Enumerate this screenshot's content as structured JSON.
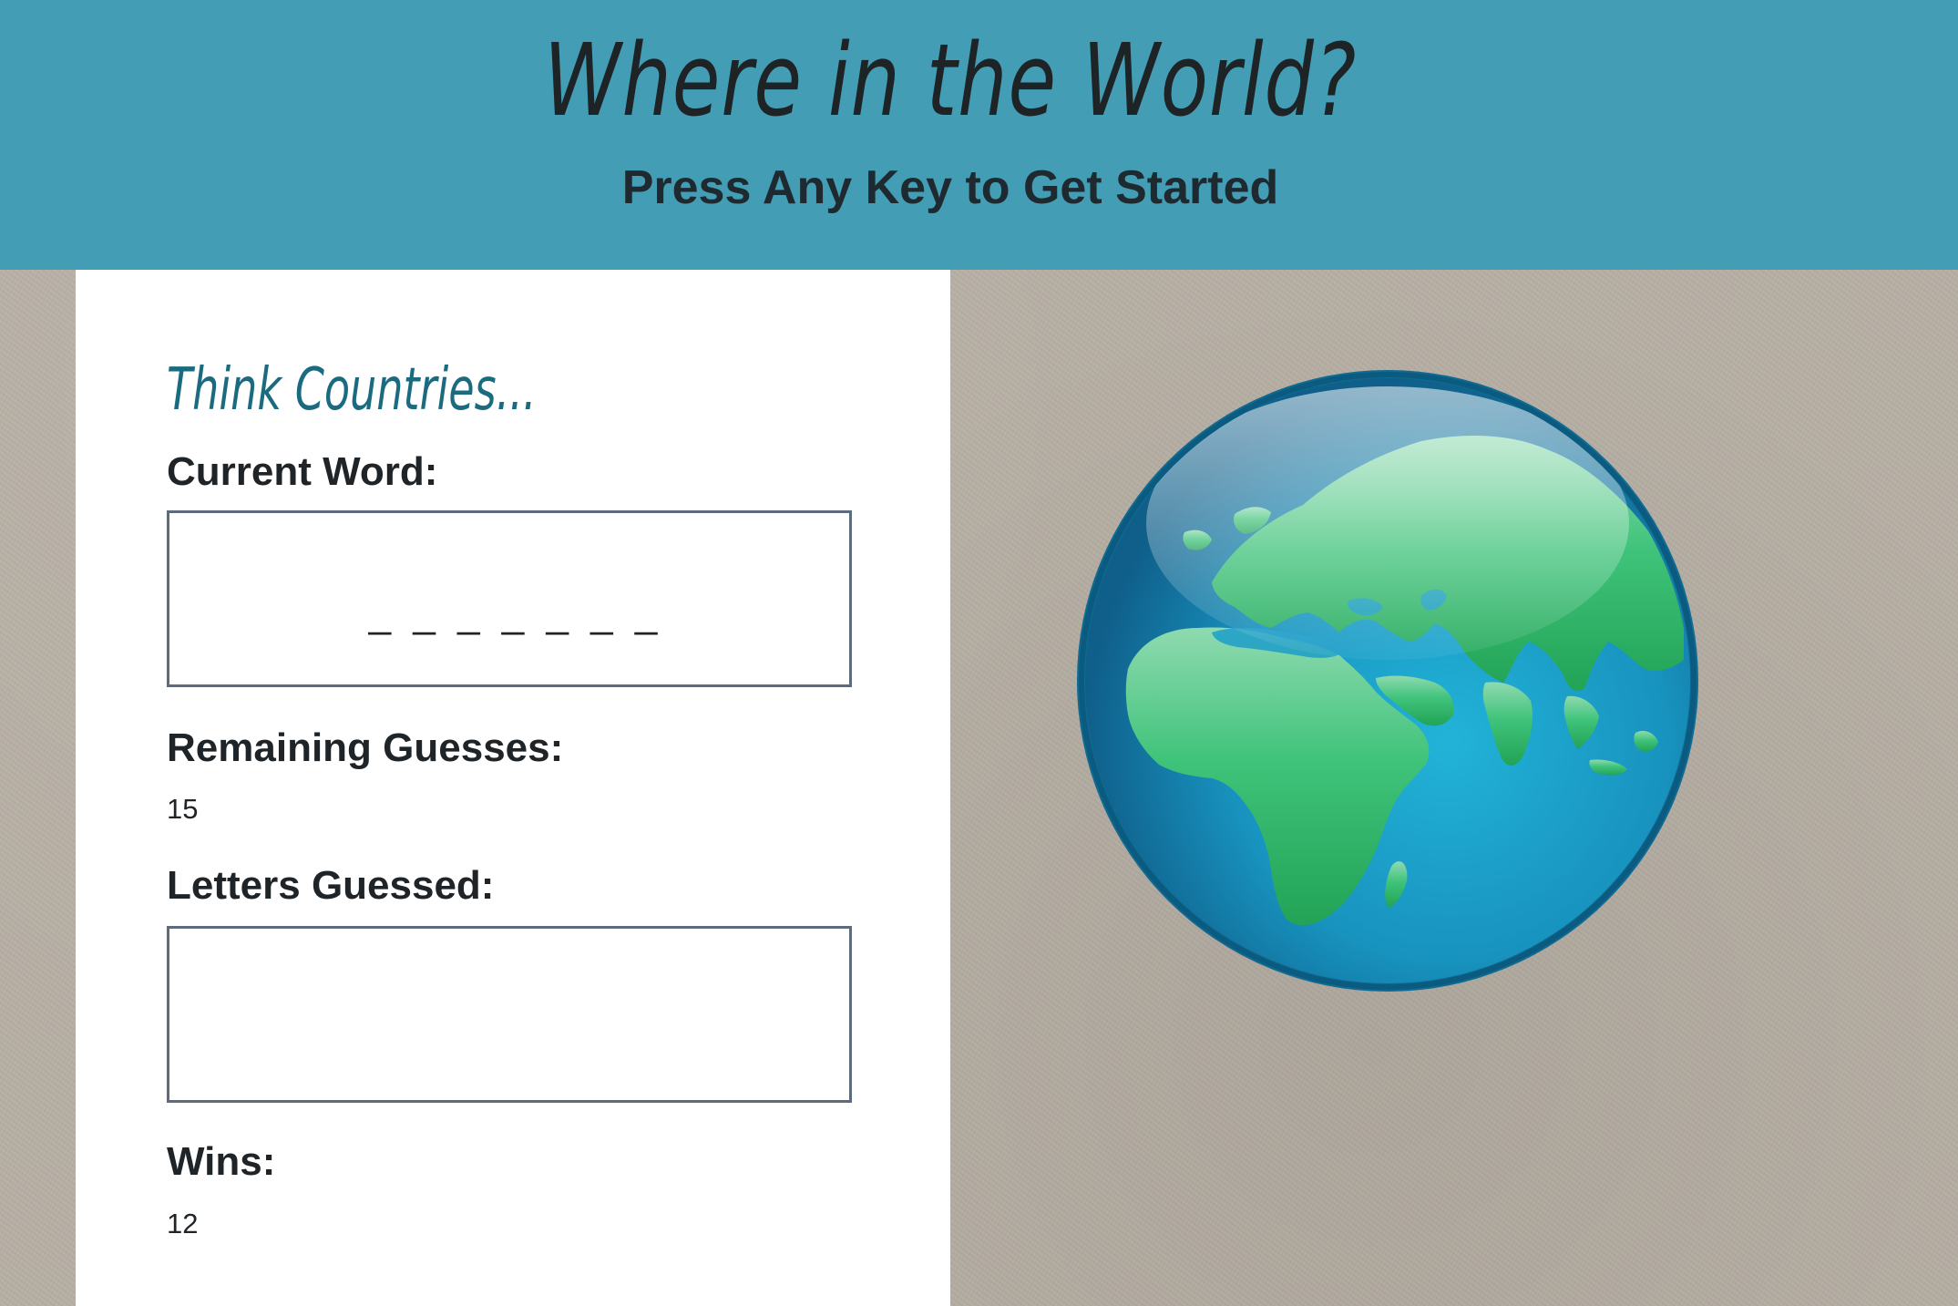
{
  "header": {
    "title": "Where in the World?",
    "subtitle": "Press Any Key to Get Started",
    "background_color": "#429db5"
  },
  "game": {
    "category": "Think Countries...",
    "current_word_label": "Current Word:",
    "current_word": "_ _ _ _ _ _ _",
    "remaining_label": "Remaining Guesses:",
    "remaining_value": "15",
    "letters_label": "Letters Guessed:",
    "letters_value": "",
    "wins_label": "Wins:",
    "wins_value": "12"
  },
  "image": {
    "icon": "globe-icon"
  }
}
